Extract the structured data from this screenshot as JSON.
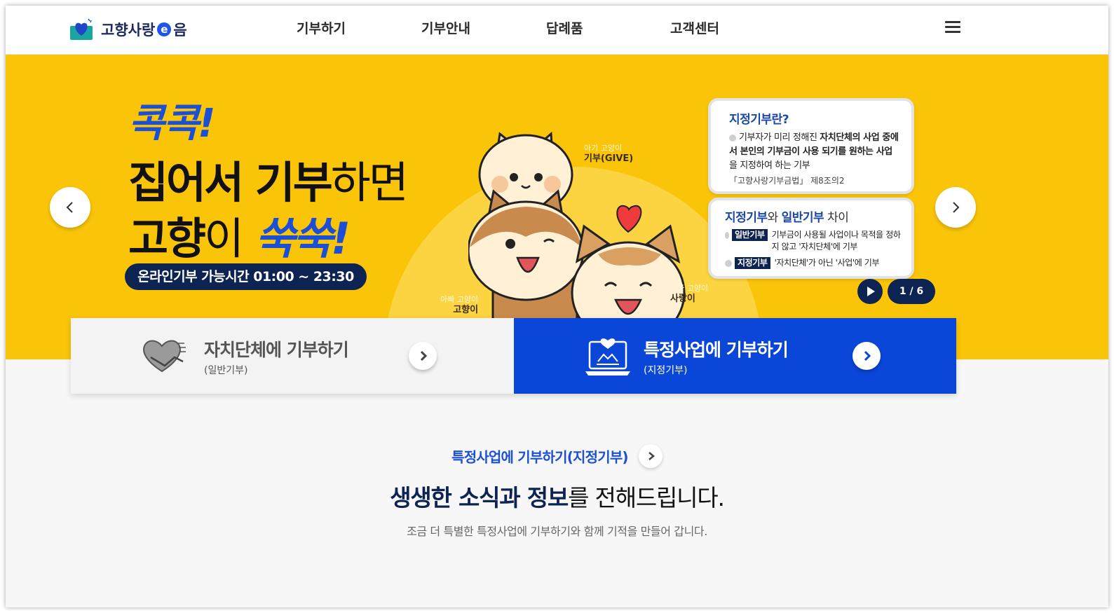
{
  "header": {
    "logo_text_1": "고향사랑",
    "logo_e": "e",
    "logo_text_2": "음",
    "nav": [
      "기부하기",
      "기부안내",
      "답례품",
      "고객센터"
    ]
  },
  "hero": {
    "kicker": "콕콕!",
    "line1_bold": "집어서 기부",
    "line1_thin": "하면",
    "line2_bold": "고향",
    "line2_thin": "이",
    "line2_blue": "쑥쑥!",
    "hours": "온라인기부 가능시간 01:00 ~ 23:30",
    "characters": {
      "baby_small": "아기 고양이",
      "baby_name": "기부(GIVE)",
      "dad_small": "아빠 고양이",
      "dad_name": "고향이",
      "mom_small": "엄마 고양이",
      "mom_name": "사랑이"
    },
    "card1": {
      "title": "지정기부란?",
      "body_1": "기부자가 미리 정해진 ",
      "body_bold_1": "자치단체의 사업 중에서 본인의 기부금이 사용 되기를 원하는 사업",
      "body_2": "을 지정하여 하는 기부",
      "law": "「고향사랑기부금법」 제8조의2"
    },
    "card2": {
      "title_bold_1": "지정기부",
      "title_mid": "와 ",
      "title_bold_2": "일반기부",
      "title_end": " 차이",
      "row1_tag": "일반기부",
      "row1_text": "기부금이 사용될 사업이나 목적을 정하지 않고 '자치단체'에 기부",
      "row2_tag": "지정기부",
      "row2_text": "'자치단체'가 아닌 '사업'에 기부"
    },
    "slide_counter": "1 / 6"
  },
  "donate": {
    "left_title": "자치단체에 기부하기",
    "left_sub": "(일반기부)",
    "right_title": "특정사업에 기부하기",
    "right_sub": "(지정기부)"
  },
  "section": {
    "link": "특정사업에 기부하기(지정기부)",
    "headline_bold": "생생한 소식과 정보",
    "headline_rest": "를 전해드립니다.",
    "subline": "조금 더 특별한 특정사업에 기부하기와 함께 기적을 만들어 갑니다."
  },
  "colors": {
    "hero_bg": "#fac509",
    "brand_blue": "#0a46d8",
    "navy": "#0d2351"
  },
  "icons": [
    "logo-heart-icon",
    "hamburger-icon",
    "chevron-left-icon",
    "chevron-right-icon",
    "play-icon",
    "heart-hands-icon",
    "laptop-donation-icon"
  ]
}
